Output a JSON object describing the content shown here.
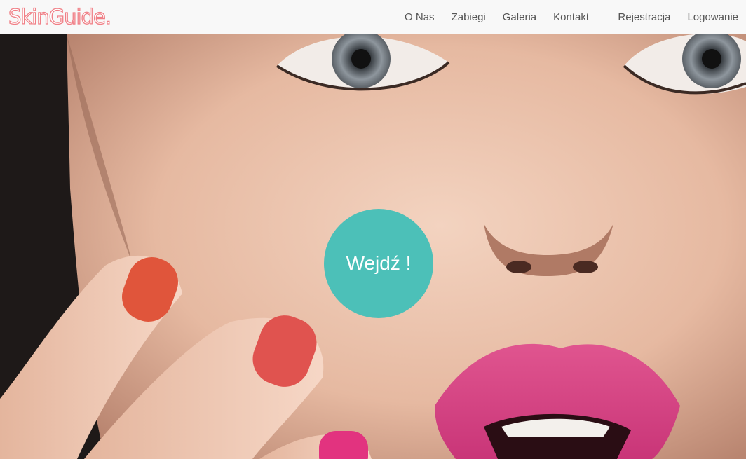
{
  "brand": {
    "name": "SkinGuide."
  },
  "nav": {
    "main": [
      {
        "label": "O Nas"
      },
      {
        "label": "Zabiegi"
      },
      {
        "label": "Galeria"
      },
      {
        "label": "Kontakt"
      }
    ],
    "account": [
      {
        "label": "Rejestracja"
      },
      {
        "label": "Logowanie"
      }
    ]
  },
  "hero": {
    "cta_label": "Wejdź !",
    "cta_color": "#4cc0b8",
    "brand_color": "#f07f86",
    "image_description_icon": "face-photo"
  }
}
